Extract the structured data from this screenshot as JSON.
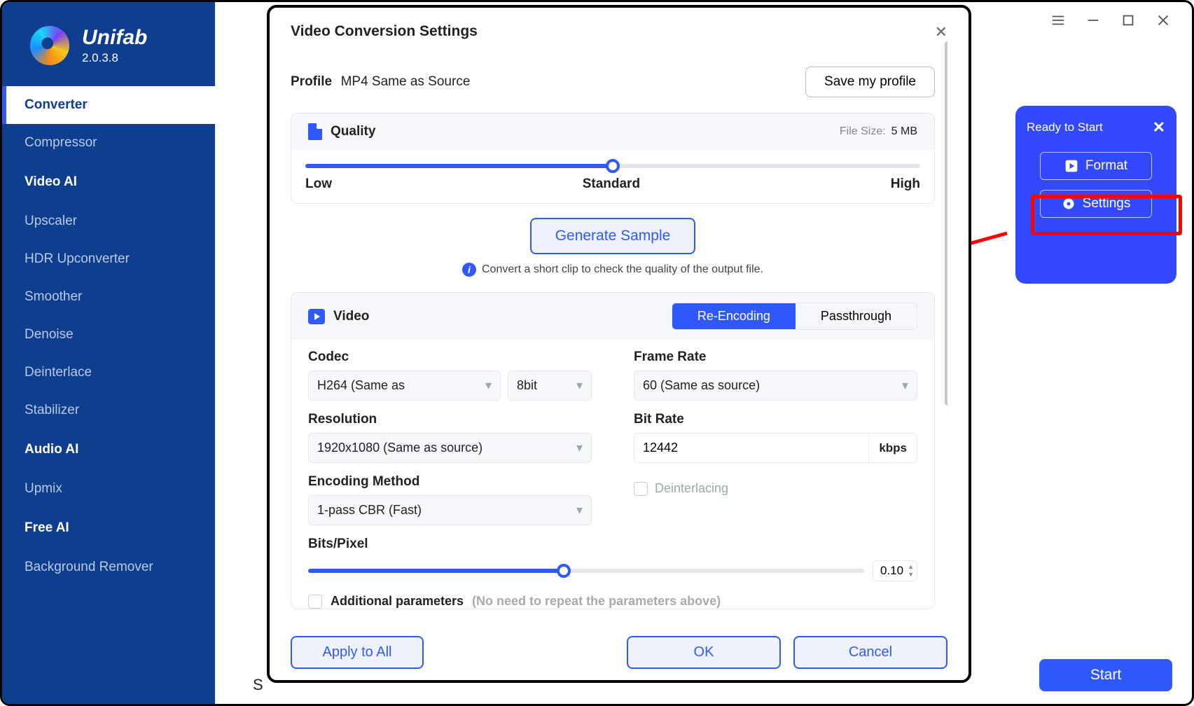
{
  "brand": {
    "name": "Unifab",
    "version": "2.0.3.8"
  },
  "titlebar": {
    "menu": "≡",
    "min": "—",
    "max": "▢",
    "close": "✕"
  },
  "sidebar": {
    "items": [
      {
        "label": "Converter",
        "type": "item",
        "active": true
      },
      {
        "label": "Compressor",
        "type": "item"
      },
      {
        "label": "Video AI",
        "type": "head"
      },
      {
        "label": "Upscaler",
        "type": "item"
      },
      {
        "label": "HDR Upconverter",
        "type": "item"
      },
      {
        "label": "Smoother",
        "type": "item"
      },
      {
        "label": "Denoise",
        "type": "item"
      },
      {
        "label": "Deinterlace",
        "type": "item"
      },
      {
        "label": "Stabilizer",
        "type": "item"
      },
      {
        "label": "Audio AI",
        "type": "head"
      },
      {
        "label": "Upmix",
        "type": "item"
      },
      {
        "label": "Free AI",
        "type": "head"
      },
      {
        "label": "Background Remover",
        "type": "item"
      }
    ]
  },
  "task_panel": {
    "status": "Ready to Start",
    "format_btn": "Format",
    "settings_btn": "Settings"
  },
  "start_btn": "Start",
  "bg_letter": "S",
  "modal": {
    "title": "Video Conversion Settings",
    "profile_label": "Profile",
    "profile_value": "MP4 Same as Source",
    "save_profile": "Save my profile",
    "quality": {
      "title": "Quality",
      "filesize_label": "File Size:",
      "filesize_value": "5 MB",
      "low": "Low",
      "standard": "Standard",
      "high": "High",
      "percent": 50
    },
    "generate_sample": "Generate Sample",
    "hint": "Convert a short clip to check the quality of the output file.",
    "video": {
      "title": "Video",
      "tab_re": "Re-Encoding",
      "tab_pass": "Passthrough",
      "codec_label": "Codec",
      "codec_value": "H264 (Same as",
      "bitdepth": "8bit",
      "framerate_label": "Frame Rate",
      "framerate_value": "60 (Same as source)",
      "resolution_label": "Resolution",
      "resolution_value": "1920x1080 (Same as source)",
      "bitrate_label": "Bit Rate",
      "bitrate_value": "12442",
      "bitrate_unit": "kbps",
      "encmethod_label": "Encoding Method",
      "encmethod_value": "1-pass CBR (Fast)",
      "deinterlacing": "Deinterlacing",
      "bitspixel_label": "Bits/Pixel",
      "bitspixel_value": "0.10",
      "bitspixel_percent": 46,
      "additional_label": "Additional parameters",
      "additional_hint": "(No need to repeat the parameters above)"
    },
    "footer": {
      "apply": "Apply to All",
      "ok": "OK",
      "cancel": "Cancel"
    }
  }
}
